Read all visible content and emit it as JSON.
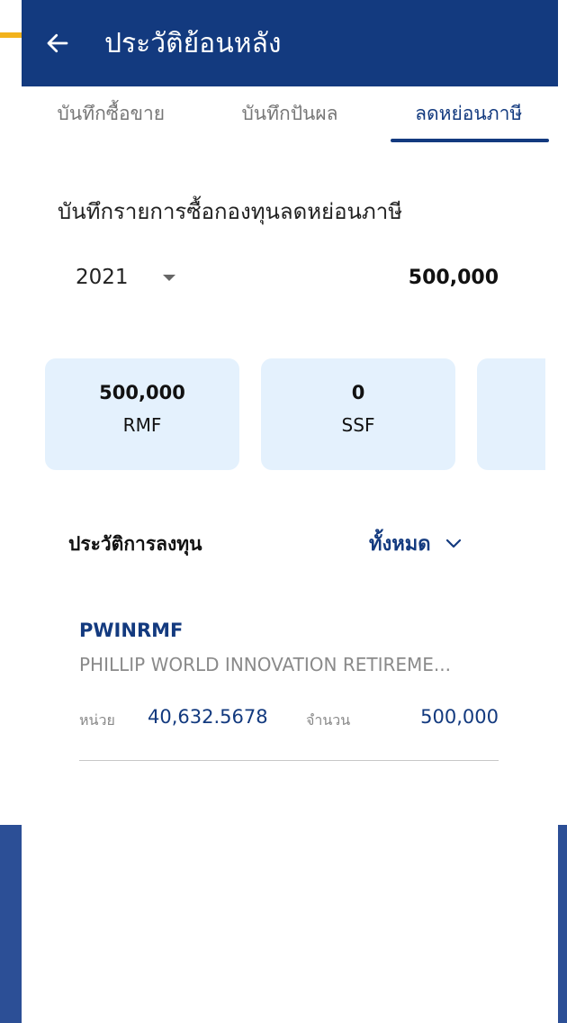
{
  "header": {
    "title": "ประวัติย้อนหลัง",
    "back_icon": "arrow-left-icon"
  },
  "tabs": [
    {
      "label": "บันทึกซื้อขาย",
      "active": false
    },
    {
      "label": "บันทึกปันผล",
      "active": false
    },
    {
      "label": "ลดหย่อนภาษี",
      "active": true
    }
  ],
  "section": {
    "heading": "บันทึกรายการซื้อกองทุนลดหย่อนภาษี",
    "year": "2021",
    "total": "500,000"
  },
  "cards": [
    {
      "value": "500,000",
      "label": "RMF"
    },
    {
      "value": "0",
      "label": "SSF"
    }
  ],
  "history": {
    "title": "ประวัติการลงทุน",
    "filter": "ทั้งหมด",
    "items": [
      {
        "code": "PWINRMF",
        "name": "PHILLIP WORLD INNOVATION RETIREME...",
        "units_label": "หน่วย",
        "units": "40,632.5678",
        "amount_label": "จำนวน",
        "amount": "500,000"
      }
    ]
  },
  "colors": {
    "primary": "#133a7f",
    "card_bg": "#e4f1fd",
    "accent": "#f2b21c"
  }
}
